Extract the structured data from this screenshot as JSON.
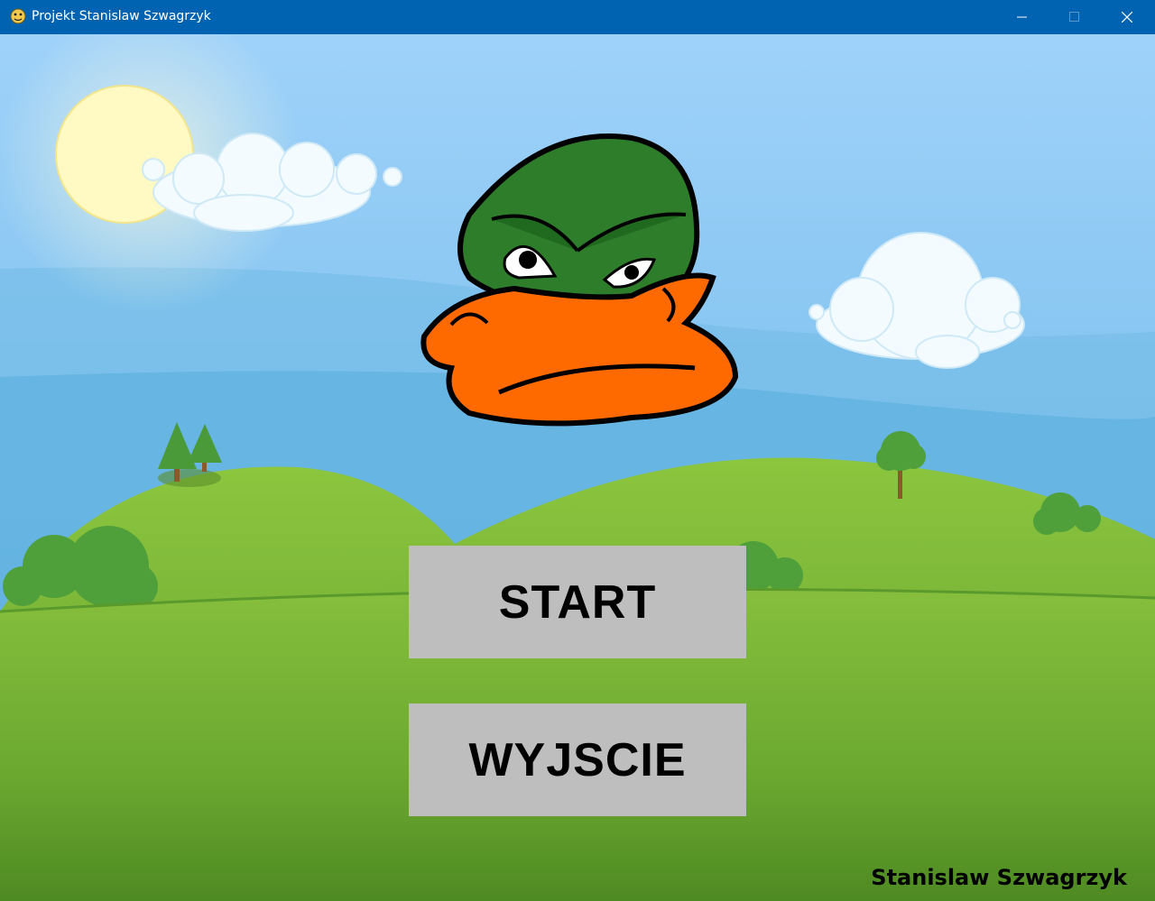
{
  "window": {
    "title": "Projekt Stanislaw Szwagrzyk",
    "app_icon": "python-snake-icon",
    "controls": [
      "minimize-icon",
      "maximize-icon",
      "close-icon"
    ]
  },
  "menu": {
    "start_label": "START",
    "exit_label": "WYJSCIE"
  },
  "footer": {
    "author": "Stanislaw Szwagrzyk"
  },
  "colors": {
    "titlebar": "#0063b1",
    "button_bg": "#bebebe",
    "sky_top": "#a7d6f7",
    "sky_bottom": "#5aaedc",
    "grass": "#7cb537",
    "duck_head": "#2e7d2b",
    "duck_beak": "#ff6a00"
  }
}
